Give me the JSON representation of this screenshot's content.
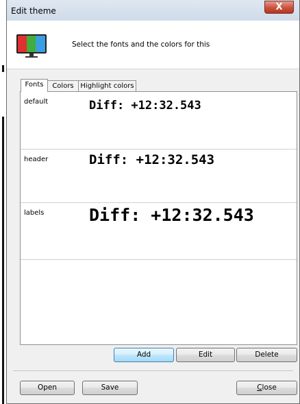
{
  "window": {
    "title": "Edit theme",
    "close_glyph": "X"
  },
  "header": {
    "icon": "monitor-icon",
    "text": "Select the fonts and the colors for this"
  },
  "tabs": [
    {
      "label": "Fonts",
      "active": true
    },
    {
      "label": "Colors",
      "active": false
    },
    {
      "label": "Highlight colors",
      "active": false
    }
  ],
  "fonts": [
    {
      "name": "default",
      "sample": "Diff: +12:32.543"
    },
    {
      "name": "header",
      "sample": "Diff: +12:32.543"
    },
    {
      "name": "labels",
      "sample": "Diff: +12:32.543"
    }
  ],
  "buttons": {
    "add": "Add",
    "edit": "Edit",
    "delete": "Delete",
    "open": "Open",
    "save": "Save",
    "close_prefix": "C",
    "close_rest": "lose"
  },
  "colors": {
    "title_bar": "#cfdbe9",
    "close": "#c8523e",
    "dialog_bg": "#f0f0f0",
    "default_button": "#bee6fd"
  }
}
